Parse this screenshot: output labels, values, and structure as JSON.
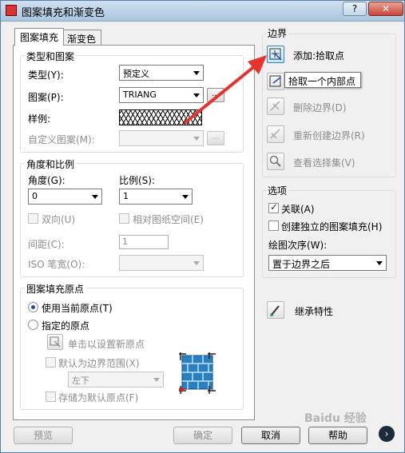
{
  "window": {
    "title": "图案填充和渐变色",
    "help_btn": "?",
    "close_btn": "✕"
  },
  "tabs": [
    {
      "label": "图案填充",
      "active": true
    },
    {
      "label": "渐变色",
      "active": false
    }
  ],
  "type_pattern": {
    "title": "类型和图案",
    "type_label": "类型(Y):",
    "type_value": "预定义",
    "pattern_label": "图案(P):",
    "pattern_value": "TRIANG",
    "pattern_ellipsis": "...",
    "sample_label": "样例:",
    "custom_label": "自定义图案(M):",
    "custom_ellipsis": "..."
  },
  "angle_scale": {
    "title": "角度和比例",
    "angle_label": "角度(G):",
    "angle_value": "0",
    "scale_label": "比例(S):",
    "scale_value": "1",
    "double_label": "双向(U)",
    "relative_label": "相对图纸空间(E)",
    "spacing_label": "间距(C):",
    "spacing_value": "1",
    "iso_label": "ISO 笔宽(O):"
  },
  "origin": {
    "title": "图案填充原点",
    "current_label": "使用当前原点(T)",
    "specified_label": "指定的原点",
    "click_set_label": "单击以设置新原点",
    "default_extent_label": "默认为边界范围(X)",
    "extent_value": "左下",
    "store_default_label": "存储为默认原点(F)"
  },
  "boundary": {
    "title": "边界",
    "add_pick": "添加:拾取点",
    "tooltip": "拾取一个内部点",
    "remove": "删除边界(D)",
    "recreate": "重新创建边界(R)",
    "view_set": "查看选择集(V)"
  },
  "options": {
    "title": "选项",
    "assoc_label": "关联(A)",
    "assoc_checked": true,
    "independent_label": "创建独立的图案填充(H)",
    "independent_checked": false,
    "draw_order_label": "绘图次序(W):",
    "draw_order_value": "置于边界之后"
  },
  "inherit": {
    "label": "继承特性"
  },
  "buttons": {
    "preview": "预览",
    "ok": "确定",
    "cancel": "取消",
    "help": "帮助",
    "expand": "›"
  },
  "watermark": "Baidu 经验",
  "colors": {
    "accent_arrow": "#e8322e",
    "title_gradient": "#a9c5de"
  }
}
